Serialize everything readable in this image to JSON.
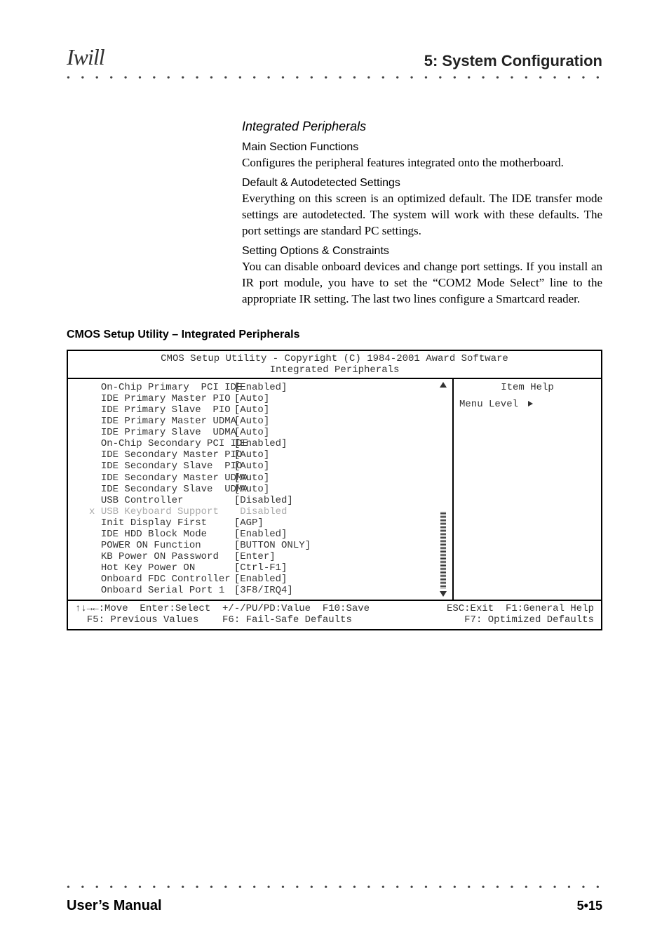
{
  "header": {
    "logo_text": "Iwill",
    "section_title": "5: System Configuration"
  },
  "content": {
    "heading_italic": "Integrated Peripherals",
    "h1": "Main Section Functions",
    "p1": "Configures the peripheral features integrated onto the motherboard.",
    "h2": "Default & Autodetected Settings",
    "p2": "Everything on this screen is an optimized default. The IDE transfer mode settings are autodetected. The system will work with these defaults. The port settings are standard PC settings.",
    "h3": "Setting Options & Constraints",
    "p3": "You can disable onboard devices and change port settings. If you install an IR port module, you have to set the “COM2 Mode Select” line to the appropriate IR setting. The last two lines configure a Smartcard reader.",
    "utility_title": "CMOS Setup Utility – Integrated Peripherals"
  },
  "bios": {
    "title_line": "CMOS Setup Utility - Copyright (C) 1984-2001 Award Software",
    "subtitle_line": "Integrated Peripherals",
    "rows": [
      {
        "label": "On-Chip Primary  PCI IDE",
        "value": "[Enabled]",
        "dim": false,
        "prefix": "  "
      },
      {
        "label": "IDE Primary Master PIO",
        "value": "[Auto]",
        "dim": false,
        "prefix": "  "
      },
      {
        "label": "IDE Primary Slave  PIO",
        "value": "[Auto]",
        "dim": false,
        "prefix": "  "
      },
      {
        "label": "IDE Primary Master UDMA",
        "value": "[Auto]",
        "dim": false,
        "prefix": "  "
      },
      {
        "label": "IDE Primary Slave  UDMA",
        "value": "[Auto]",
        "dim": false,
        "prefix": "  "
      },
      {
        "label": "On-Chip Secondary PCI IDE",
        "value": "[Enabled]",
        "dim": false,
        "prefix": "  "
      },
      {
        "label": "IDE Secondary Master PIO",
        "value": "[Auto]",
        "dim": false,
        "prefix": "  "
      },
      {
        "label": "IDE Secondary Slave  PIO",
        "value": "[Auto]",
        "dim": false,
        "prefix": "  "
      },
      {
        "label": "IDE Secondary Master UDMA",
        "value": "[Auto]",
        "dim": false,
        "prefix": "  "
      },
      {
        "label": "IDE Secondary Slave  UDMA",
        "value": "[Auto]",
        "dim": false,
        "prefix": "  "
      },
      {
        "label": "USB Controller",
        "value": "[Disabled]",
        "dim": false,
        "prefix": "  "
      },
      {
        "label": "USB Keyboard Support",
        "value": " Disabled",
        "dim": true,
        "prefix": "x "
      },
      {
        "label": "Init Display First",
        "value": "[AGP]",
        "dim": false,
        "prefix": "  "
      },
      {
        "label": "IDE HDD Block Mode",
        "value": "[Enabled]",
        "dim": false,
        "prefix": "  "
      },
      {
        "label": "POWER ON Function",
        "value": "[BUTTON ONLY]",
        "dim": false,
        "prefix": "  "
      },
      {
        "label": "KB Power ON Password",
        "value": "[Enter]",
        "dim": false,
        "prefix": "  "
      },
      {
        "label": "Hot Key Power ON",
        "value": "[Ctrl-F1]",
        "dim": false,
        "prefix": "  "
      },
      {
        "label": "Onboard FDC Controller",
        "value": "[Enabled]",
        "dim": false,
        "prefix": "  "
      },
      {
        "label": "Onboard Serial Port 1",
        "value": "[3F8/IRQ4]",
        "dim": false,
        "prefix": "  "
      }
    ],
    "help_title": "Item Help",
    "menu_level": "Menu Level",
    "keys_line1_left": "↑↓→←:Move  Enter:Select  +/-/PU/PD:Value  F10:Save",
    "keys_line1_right": "ESC:Exit  F1:General Help",
    "keys_line2_left": "  F5: Previous Values    F6: Fail-Safe Defaults",
    "keys_line2_right": "F7: Optimized Defaults"
  },
  "footer": {
    "left": "User’s Manual",
    "right": "5•15"
  }
}
